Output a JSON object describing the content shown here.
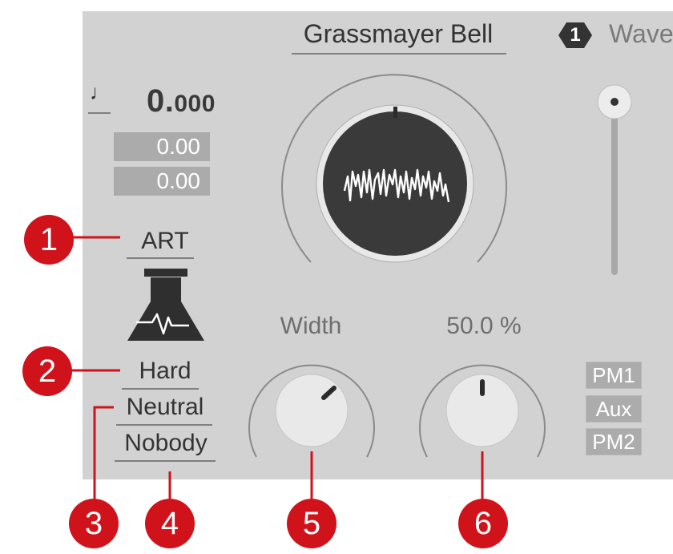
{
  "preset": {
    "title": "Grassmayer Bell",
    "slot_number": "1",
    "slot_label": "Wave"
  },
  "tempo": {
    "icon": "note-icon",
    "value_major": "0.",
    "value_minor": "000",
    "field_1": "0.00",
    "field_2": "0.00"
  },
  "category": {
    "label": "ART",
    "icon": "flask-icon",
    "character": "Hard",
    "mood": "Neutral",
    "author": "Nobody"
  },
  "knobs": {
    "width_label": "Width",
    "mix_label": "50.0 %"
  },
  "routing": {
    "items": [
      "PM1",
      "Aux",
      "PM2"
    ]
  },
  "callouts": [
    "1",
    "2",
    "3",
    "4",
    "5",
    "6"
  ],
  "colors": {
    "panel": "#d2d2d2",
    "callout": "#d0131b",
    "display": "#333333"
  }
}
